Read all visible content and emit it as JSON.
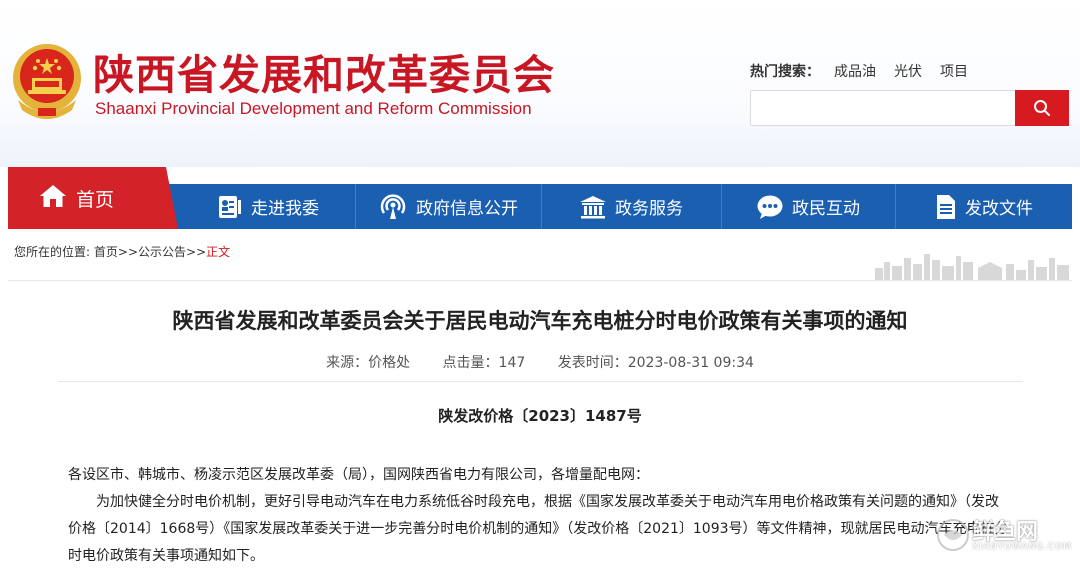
{
  "header": {
    "title_cn": "陕西省发展和改革委员会",
    "title_en": "Shaanxi Provincial Development and Reform Commission",
    "hot_search_label": "热门搜索：",
    "hot_keywords": [
      "成品油",
      "光伏",
      "项目"
    ],
    "search_placeholder": "",
    "search_icon": "search-icon"
  },
  "nav": {
    "home": {
      "label": "首页",
      "icon": "home-icon"
    },
    "items": [
      {
        "label": "走进我委",
        "icon": "document-user-icon"
      },
      {
        "label": "政府信息公开",
        "icon": "broadcast-icon"
      },
      {
        "label": "政务服务",
        "icon": "building-icon"
      },
      {
        "label": "政民互动",
        "icon": "chat-icon"
      },
      {
        "label": "发改文件",
        "icon": "file-icon"
      }
    ]
  },
  "breadcrumb": {
    "prefix": "您所在的位置:",
    "home": "首页",
    "sep1": ">>",
    "section": "公示公告",
    "sep2": ">>",
    "current": "正文"
  },
  "article": {
    "title": "陕西省发展和改革委员会关于居民电动汽车充电桩分时电价政策有关事项的通知",
    "source": "来源：价格处",
    "clicks": "点击量：147",
    "published": "发表时间：2023-08-31 09:34",
    "doc_number": "陕发改价格〔2023〕1487号",
    "addressee": "各设区市、韩城市、杨凌示范区发展改革委（局），国网陕西省电力有限公司，各增量配电网：",
    "para1": "为加快健全分时电价机制，更好引导电动汽车在电力系统低谷时段充电，根据《国家发展改革委关于电动汽车用电价格政策有关问题的通知》（发改价格〔2014〕1668号）《国家发展改革委关于进一步完善分时电价机制的通知》（发改价格〔2021〕1093号）等文件精神，现就居民电动汽车充电桩分时电价政策有关事项通知如下。"
  },
  "watermark": {
    "cn": "鲜鱼网",
    "en": "XIANYUWANG.COM"
  },
  "colors": {
    "brand_red": "#c81623",
    "nav_blue": "#1b5fb1",
    "home_red": "#d32228"
  }
}
